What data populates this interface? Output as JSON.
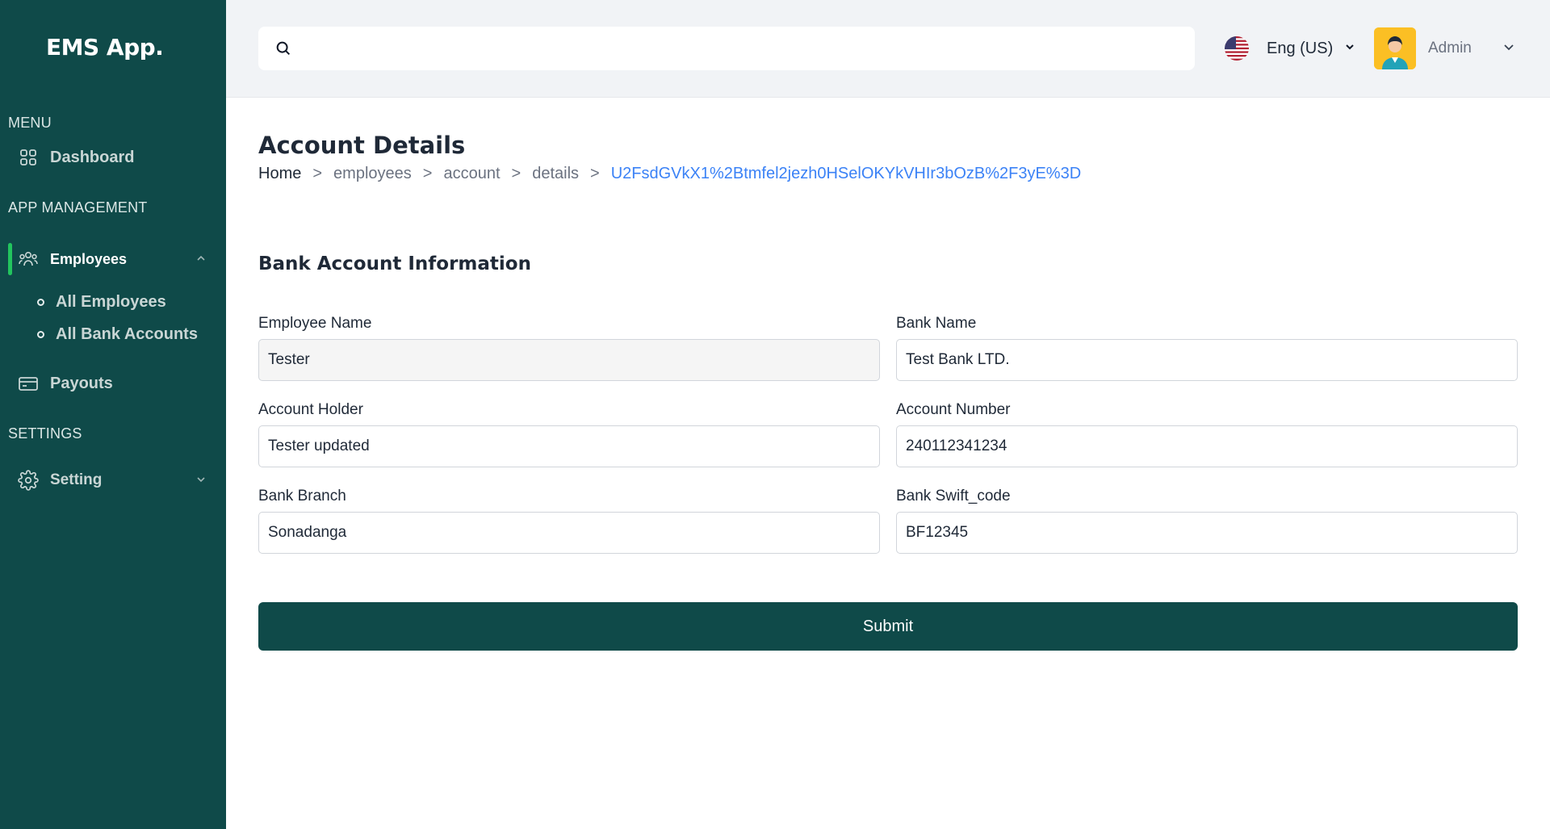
{
  "app": {
    "brand": "EMS App."
  },
  "sidebar": {
    "sections": {
      "menu": "MENU",
      "app_management": "APP MANAGEMENT",
      "settings": "SETTINGS"
    },
    "items": {
      "dashboard": "Dashboard",
      "employees": "Employees",
      "all_employees": "All Employees",
      "all_bank_accounts": "All Bank Accounts",
      "payouts": "Payouts",
      "setting": "Setting"
    },
    "active_accent": "#22c55e",
    "background": "#0f4a49"
  },
  "topbar": {
    "search": {
      "placeholder": "",
      "value": ""
    },
    "language": {
      "label": "Eng (US)",
      "icon": "us-flag-icon"
    },
    "user": {
      "name": "Admin",
      "icon": "avatar"
    }
  },
  "page": {
    "title": "Account Details",
    "breadcrumb": {
      "home": "Home",
      "sep": ">",
      "items": [
        "employees",
        "account",
        "details"
      ],
      "current": "U2FsdGVkX1%2Btmfel2jezh0HSelOKYkVHIr3bOzB%2F3yE%3D"
    }
  },
  "form": {
    "title": "Bank Account Information",
    "fields": {
      "employee_name": {
        "label": "Employee Name",
        "value": "Tester"
      },
      "bank_name": {
        "label": "Bank Name",
        "value": "Test Bank LTD."
      },
      "account_holder": {
        "label": "Account Holder",
        "value": "Tester updated"
      },
      "account_number": {
        "label": "Account Number",
        "value": "240112341234"
      },
      "bank_branch": {
        "label": "Bank Branch",
        "value": "Sonadanga"
      },
      "swift_code": {
        "label": "Bank Swift_code",
        "value": "BF12345"
      }
    },
    "submit_label": "Submit"
  }
}
